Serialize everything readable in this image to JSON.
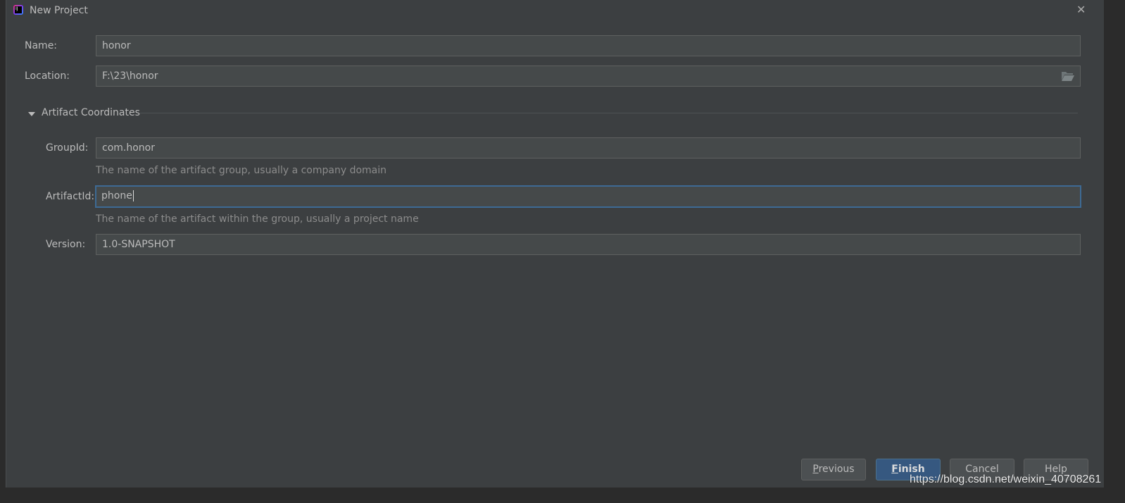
{
  "window": {
    "title": "New Project"
  },
  "fields": {
    "name": {
      "label": "Name:",
      "value": "honor"
    },
    "location": {
      "label": "Location:",
      "value": "F:\\23\\honor"
    }
  },
  "section": {
    "title": "Artifact Coordinates"
  },
  "artifact": {
    "group_id": {
      "label": "GroupId:",
      "value": "com.honor",
      "hint": "The name of the artifact group, usually a company domain"
    },
    "artifact_id": {
      "label": "ArtifactId:",
      "value": "phone",
      "hint": "The name of the artifact within the group, usually a project name"
    },
    "version": {
      "label": "Version:",
      "value": "1.0-SNAPSHOT"
    }
  },
  "buttons": {
    "previous": {
      "mnemonic": "P",
      "rest": "revious"
    },
    "finish": {
      "mnemonic": "F",
      "rest": "inish"
    },
    "cancel": "Cancel",
    "help": "Help"
  },
  "watermark": "https://blog.csdn.net/weixin_40708261"
}
